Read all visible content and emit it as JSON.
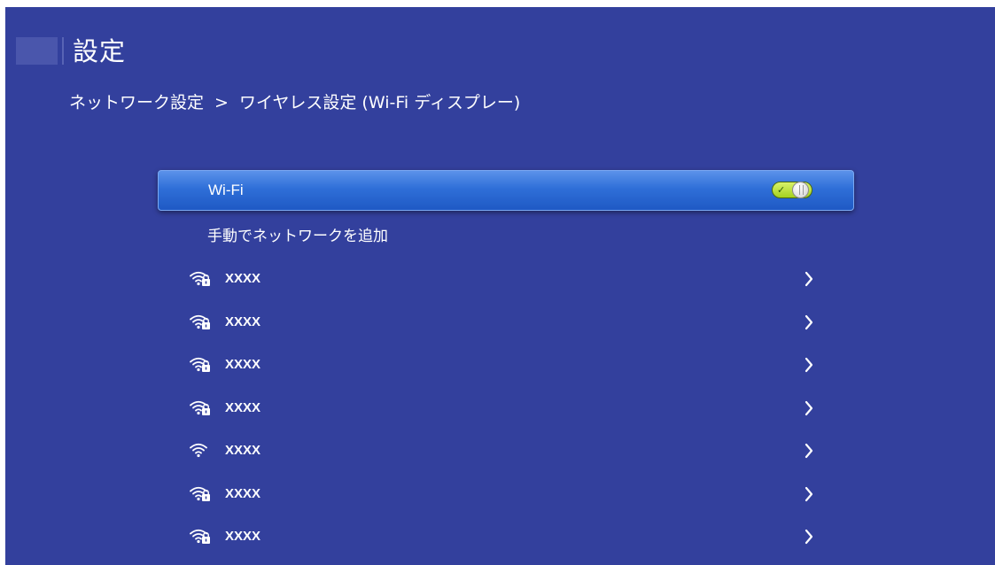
{
  "header": {
    "title": "設定"
  },
  "breadcrumb": {
    "parent": "ネットワーク設定",
    "separator": ">",
    "current": "ワイヤレス設定 (Wi-Fi ディスプレー)"
  },
  "wifi_toggle": {
    "label": "Wi-Fi",
    "state": "on",
    "check": "✓"
  },
  "manual_add": {
    "label": "手動でネットワークを追加"
  },
  "networks": [
    {
      "name": "XXXX",
      "icon": "wifi-locked-icon"
    },
    {
      "name": "XXXX",
      "icon": "wifi-locked-icon"
    },
    {
      "name": "XXXX",
      "icon": "wifi-locked-icon"
    },
    {
      "name": "XXXX",
      "icon": "wifi-locked-icon"
    },
    {
      "name": "XXXX",
      "icon": "wifi-icon"
    },
    {
      "name": "XXXX",
      "icon": "wifi-locked-icon"
    },
    {
      "name": "XXXX",
      "icon": "wifi-locked-icon"
    }
  ],
  "colors": {
    "background": "#33409d",
    "selected_row": "#2f6fd8",
    "toggle_on": "#a4d21e",
    "text": "#ffffff"
  }
}
